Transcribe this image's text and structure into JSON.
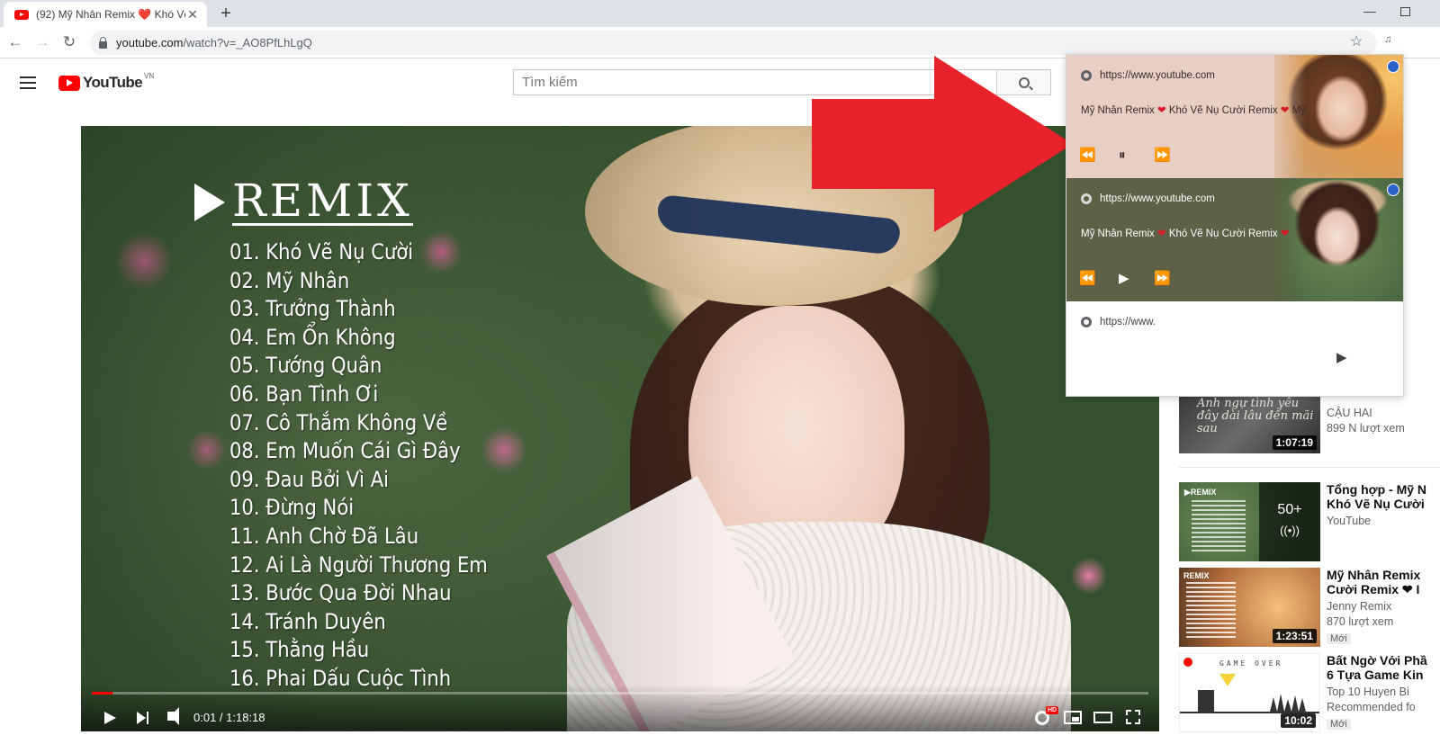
{
  "browser": {
    "tab_title": "(92) Mỹ Nhân Remix ❤️ Khó Vẽ Nụ",
    "new_tab": "+",
    "url_host": "youtube.com",
    "url_path": "/watch?v=_AO8PfLhLgQ"
  },
  "youtube": {
    "logo_text": "YouTube",
    "region": "VN",
    "search_placeholder": "Tìm kiếm"
  },
  "video": {
    "remix_label": "REMIX",
    "tracks": [
      "01. Khó Vẽ Nụ Cười",
      "02. Mỹ Nhân",
      "03. Trưởng Thành",
      "04. Em Ổn Không",
      "05. Tướng Quân",
      "06. Bạn Tình Ơi",
      "07. Cô Thắm Không Về",
      "08. Em Muốn Cái Gì Đây",
      "09. Đau Bởi Vì Ai",
      "10. Đừng Nói",
      "11. Anh Chờ Đã Lâu",
      "12. Ai Là Người Thương Em",
      "13. Bước Qua Đời Nhau",
      "14. Tránh Duyên",
      "15. Thằng Hầu",
      "16. Phai Dấu Cuộc Tình"
    ],
    "time": "0:01 / 1:18:18",
    "progress_fraction": 0.0002,
    "hd_badge": "HD"
  },
  "suggestions": [
    {
      "thumb_text": "Anh ngự tình yêu đây dài lâu đến mãi sau",
      "duration": "1:07:19",
      "title": "",
      "channel": "CẬU HAI",
      "views": "899 N lượt xem",
      "badge": ""
    },
    {
      "thumb_text": "50+",
      "duration": "",
      "title": "Tổng hợp - Mỹ N",
      "title2": "Khó Vẽ Nụ Cười",
      "channel": "YouTube",
      "views": "",
      "badge": ""
    },
    {
      "thumb_text": "REMIX",
      "duration": "1:23:51",
      "title": "Mỹ Nhân Remix",
      "title2": "Cười Remix ❤ I",
      "channel": "Jenny Remix",
      "views": "870 lượt xem",
      "badge": "Mới"
    },
    {
      "thumb_text": "GAME OVER",
      "duration": "10:02",
      "title": "Bất Ngờ Với Phầ",
      "title2": "6 Tựa Game Kin",
      "channel": "Top 10 Huyen Bi",
      "views": "Recommended fo",
      "badge": "Mới"
    }
  ],
  "media_popup": {
    "items": [
      {
        "source": "https://www.youtube.com",
        "title_a": "Mỹ Nhân Remix ",
        "heart": "❤",
        "title_b": " Khó Vẽ Nụ Cười Remix ",
        "title_c": " Mỹ",
        "prev": "⏪",
        "state": "⏸",
        "next": "⏩"
      },
      {
        "source": "https://www.youtube.com",
        "title_a": "Mỹ Nhân Remix ",
        "heart": "❤",
        "title_b": " Khó Vẽ Nụ Cười Remix ",
        "title_c": "",
        "prev": "⏪",
        "state": "▶",
        "next": "⏩"
      },
      {
        "source": "https://www.",
        "state": "▶"
      }
    ]
  },
  "colors": {
    "annotation_arrow": "#e8222a",
    "youtube_red": "#ff0000"
  }
}
